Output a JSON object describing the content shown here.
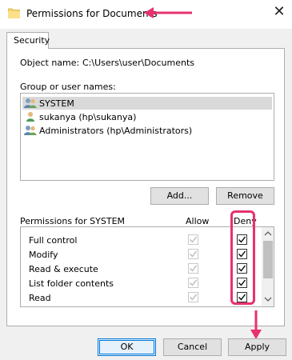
{
  "window": {
    "title": "Permissions for Documents",
    "close_glyph": "✕"
  },
  "tabs": [
    {
      "label": "Security"
    }
  ],
  "object": {
    "label": "Object name:",
    "value": "C:\\Users\\user\\Documents"
  },
  "groups": {
    "label": "Group or user names:",
    "items": [
      {
        "name": "SYSTEM",
        "icon": "group-icon",
        "selected": true
      },
      {
        "name": "sukanya (hp\\sukanya)",
        "icon": "user-icon",
        "selected": false
      },
      {
        "name": "Administrators (hp\\Administrators)",
        "icon": "group-icon",
        "selected": false
      }
    ]
  },
  "buttons": {
    "add": "Add...",
    "remove": "Remove",
    "ok": "OK",
    "cancel": "Cancel",
    "apply": "Apply"
  },
  "permissions": {
    "label": "Permissions for SYSTEM",
    "allow_header": "Allow",
    "deny_header": "Deny",
    "rows": [
      {
        "name": "Full control",
        "allow": true,
        "allow_disabled": true,
        "deny": true
      },
      {
        "name": "Modify",
        "allow": true,
        "allow_disabled": true,
        "deny": true
      },
      {
        "name": "Read & execute",
        "allow": true,
        "allow_disabled": true,
        "deny": true
      },
      {
        "name": "List folder contents",
        "allow": true,
        "allow_disabled": true,
        "deny": true
      },
      {
        "name": "Read",
        "allow": true,
        "allow_disabled": true,
        "deny": true
      }
    ]
  },
  "colors": {
    "annotation": "#e8316f",
    "accent": "#0078d7"
  }
}
